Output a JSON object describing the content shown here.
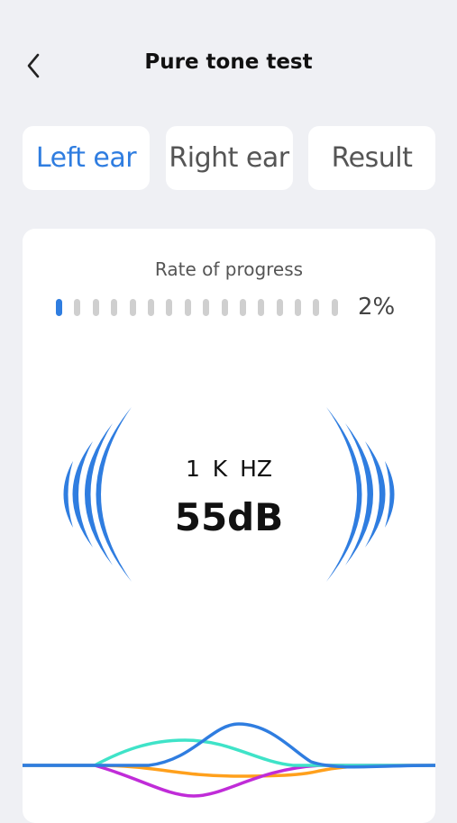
{
  "header": {
    "title": "Pure tone test"
  },
  "tabs": [
    {
      "label": "Left ear",
      "active": true
    },
    {
      "label": "Right ear",
      "active": false
    },
    {
      "label": "Result",
      "active": false
    }
  ],
  "progress": {
    "label": "Rate of progress",
    "value_text": "2%",
    "value_fraction": 0.02,
    "segments_total": 16,
    "segments_filled": 1
  },
  "tone": {
    "frequency": "1 K  HZ",
    "level": "55dB"
  },
  "colors": {
    "accent": "#2f7de0",
    "background": "#eff0f4",
    "inactive_dot": "#cfcfcf",
    "cyan": "#3fe3c8",
    "orange": "#ffa01c",
    "purple": "#c02cd8"
  },
  "icons": {
    "back": "chevron-left-icon",
    "sound": "sound-wave-arcs-icon"
  }
}
